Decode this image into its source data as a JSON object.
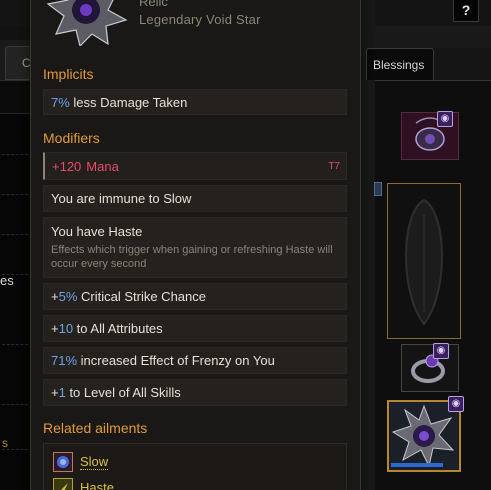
{
  "help_button": "?",
  "left_panel": {
    "tab_label": "C",
    "row_text": "es",
    "footer_text": "s"
  },
  "right_panel": {
    "tab_label": "Blessings"
  },
  "tooltip": {
    "item_type": "Relic",
    "item_name": "Legendary Void Star",
    "implicits_title": "Implicits",
    "implicits": [
      {
        "value": "7%",
        "text": " less Damage Taken"
      }
    ],
    "modifiers_title": "Modifiers",
    "mana_mod": {
      "value": "+120",
      "text": "Mana",
      "tier": "T7"
    },
    "modifiers": {
      "slow": "You are immune to Slow",
      "haste_title": "You have Haste",
      "haste_desc": "Effects which trigger when gaining or refreshing Haste will occur every second",
      "crit_value": "5%",
      "crit_text": " Critical Strike Chance",
      "attr_value": "10",
      "attr_text": " to All Attributes",
      "frenzy_value": "71%",
      "frenzy_text": " increased Effect of Frenzy on You",
      "level_value": "1",
      "level_text": " to Level of All Skills"
    },
    "related_title": "Related ailments",
    "ailments": [
      "Slow",
      "Haste"
    ]
  },
  "colors": {
    "accent_orange": "#e29a3a",
    "value_blue": "#6ea4e6",
    "mana_red": "#e64a6a",
    "ailment_yellow": "#d8c14a"
  }
}
